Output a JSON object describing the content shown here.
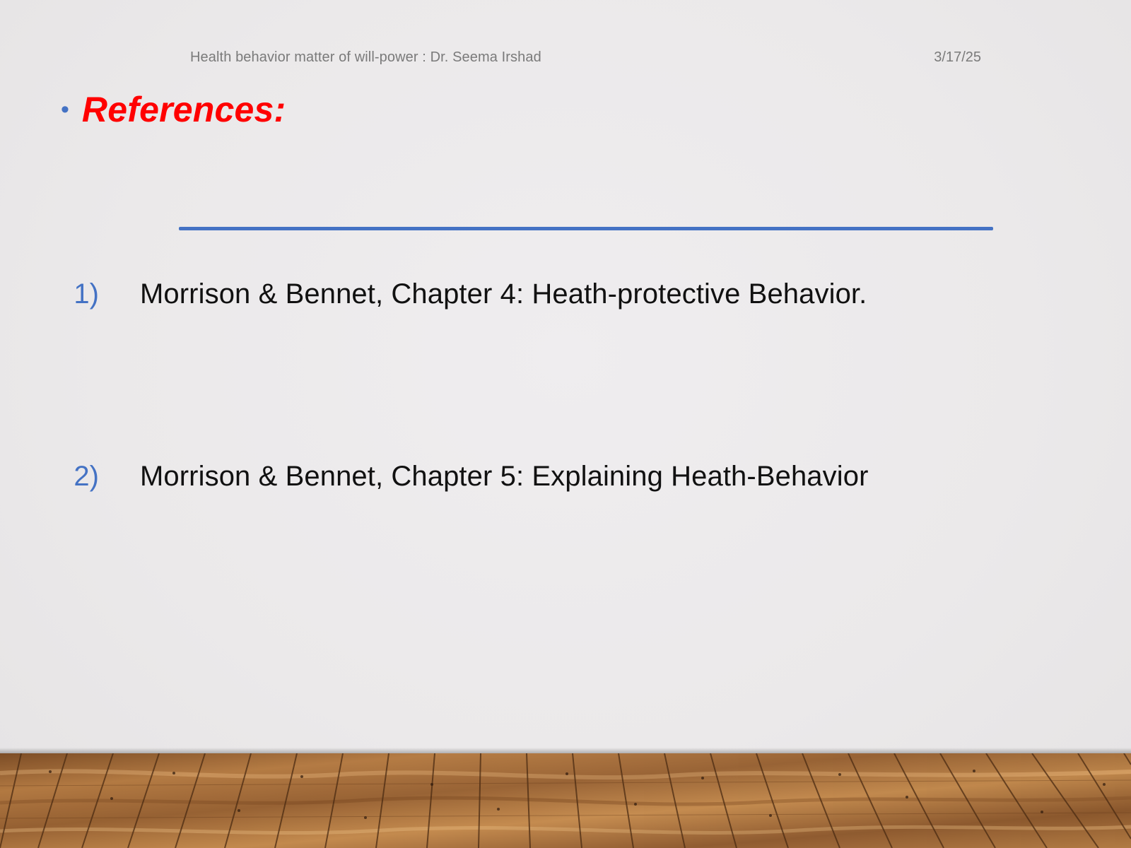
{
  "slide": {
    "header_left": "Health behavior matter of will-power : Dr. Seema Irshad",
    "header_right": "3/17/25",
    "title": "References:",
    "bullet_icon": "bullet-dot-icon",
    "colors": {
      "title": "#ff0000",
      "accent": "#4472c4",
      "body_text": "#111111",
      "header_text": "#7a7a7a",
      "background": "#ebe9ea",
      "floor_wood": "#a9743f"
    },
    "references": [
      {
        "number": "1)",
        "text": "Morrison & Bennet, Chapter 4: Heath-protective Behavior."
      },
      {
        "number": "2)",
        "text": "Morrison & Bennet, Chapter 5: Explaining Heath-Behavior"
      }
    ]
  }
}
